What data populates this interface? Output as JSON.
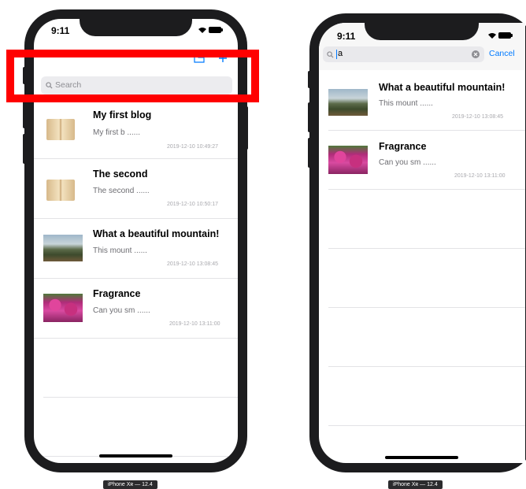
{
  "status": {
    "time": "9:11"
  },
  "left_screen": {
    "search_placeholder": "Search",
    "posts": [
      {
        "title": "My first blog",
        "excerpt": "My first b ......",
        "date": "2019-12-10 10:49:27",
        "image": "book-icon"
      },
      {
        "title": "The second",
        "excerpt": "The second ......",
        "date": "2019-12-10 10:50:17",
        "image": "book-icon"
      },
      {
        "title": "What a beautiful mountain!",
        "excerpt": "This mount ......",
        "date": "2019-12-10 13:08:45",
        "image": "mountain-photo"
      },
      {
        "title": "Fragrance",
        "excerpt": "Can you sm ......",
        "date": "2019-12-10 13:11:00",
        "image": "flowers-photo"
      }
    ]
  },
  "right_screen": {
    "search_value": "a",
    "cancel_label": "Cancel",
    "results": [
      {
        "title": "What a beautiful mountain!",
        "excerpt": "This mount ......",
        "date": "2019-12-10 13:08:45",
        "image": "mountain-photo"
      },
      {
        "title": "Fragrance",
        "excerpt": "Can you sm ......",
        "date": "2019-12-10 13:11:00",
        "image": "flowers-photo"
      }
    ]
  },
  "device_label": "iPhone Xʀ — 12.4",
  "colors": {
    "highlight": "#ff0000",
    "accent": "#007aff",
    "bezel": "#1c1c1e"
  }
}
